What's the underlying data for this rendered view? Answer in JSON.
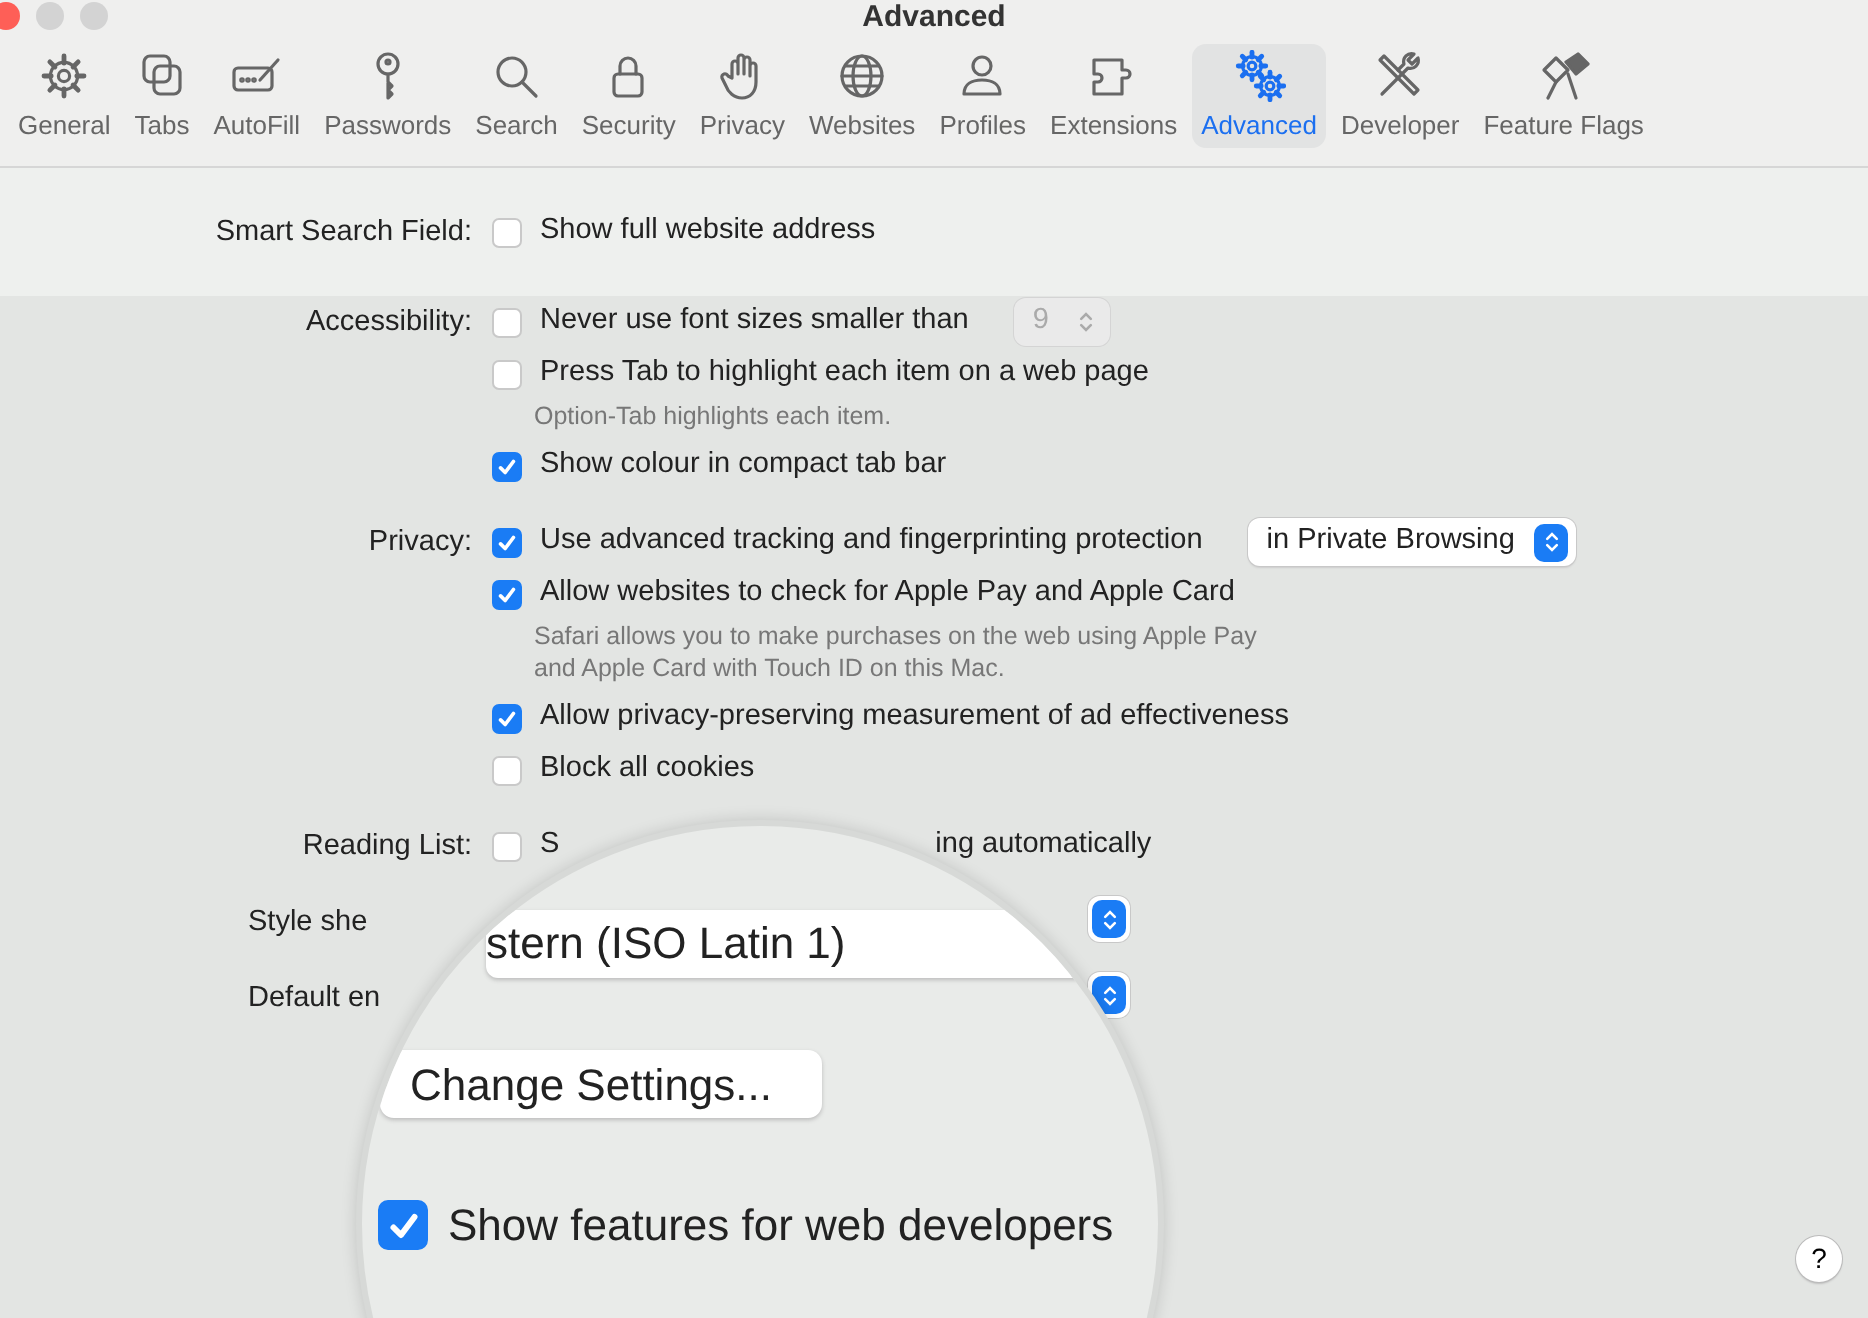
{
  "window": {
    "title": "Advanced"
  },
  "toolbar": [
    {
      "label": "General",
      "selected": false
    },
    {
      "label": "Tabs",
      "selected": false
    },
    {
      "label": "AutoFill",
      "selected": false
    },
    {
      "label": "Passwords",
      "selected": false
    },
    {
      "label": "Search",
      "selected": false
    },
    {
      "label": "Security",
      "selected": false
    },
    {
      "label": "Privacy",
      "selected": false
    },
    {
      "label": "Websites",
      "selected": false
    },
    {
      "label": "Profiles",
      "selected": false
    },
    {
      "label": "Extensions",
      "selected": false
    },
    {
      "label": "Advanced",
      "selected": true
    },
    {
      "label": "Developer",
      "selected": false
    },
    {
      "label": "Feature Flags",
      "selected": false
    }
  ],
  "sections": [
    {
      "label": "Smart Search Field:",
      "items": [
        {
          "kind": "checkbox",
          "text": "Show full website address",
          "checked": false
        }
      ]
    },
    {
      "label": "Accessibility:",
      "items": [
        {
          "kind": "checkbox",
          "text": "Never use font sizes smaller than",
          "checked": false,
          "popup": {
            "text": "9",
            "disabled": true
          }
        },
        {
          "kind": "checkbox",
          "text": "Press Tab to highlight each item on a web page",
          "checked": false
        },
        {
          "kind": "hint",
          "text": "Option-Tab highlights each item."
        },
        {
          "kind": "checkbox",
          "text": "Show colour in compact tab bar",
          "checked": true
        }
      ]
    },
    {
      "label": "Privacy:",
      "items": [
        {
          "kind": "checkbox",
          "text": "Use advanced tracking and fingerprinting protection",
          "checked": true,
          "popup": {
            "text": "in Private Browsing",
            "disabled": false
          }
        },
        {
          "kind": "checkbox",
          "text": "Allow websites to check for Apple Pay and Apple Card",
          "checked": true
        },
        {
          "kind": "hint",
          "text": "Safari allows you to make purchases on the web using Apple Pay\nand Apple Card with Touch ID on this Mac."
        },
        {
          "kind": "checkbox",
          "text": "Allow privacy-preserving measurement of ad effectiveness",
          "checked": true
        },
        {
          "kind": "checkbox",
          "text": "Block all cookies",
          "checked": false
        }
      ]
    },
    {
      "label": "Reading List:",
      "items": [
        {
          "kind": "split",
          "parts": [
            "S",
            "ing automatically"
          ],
          "checked": false
        }
      ]
    },
    {
      "label": "Style she",
      "items": [
        {
          "kind": "stepper"
        }
      ]
    },
    {
      "label": "Default en",
      "items": [
        {
          "kind": "stepper"
        }
      ]
    }
  ],
  "magnifier": {
    "popup_text": "stern (ISO Latin 1)",
    "button": "Change Settings...",
    "checkbox": {
      "text": "Show features for web developers",
      "checked": true
    }
  },
  "help_button": "?"
}
